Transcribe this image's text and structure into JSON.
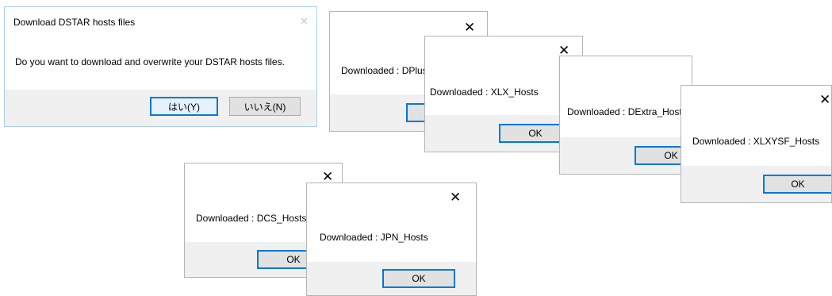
{
  "confirm_dialog": {
    "title": "Download DSTAR hosts files",
    "message": "Do you want to download and overwrite your DSTAR hosts files.",
    "yes_label": "はい(Y)",
    "no_label": "いいえ(N)"
  },
  "close_glyph": "✕",
  "message_boxes": [
    {
      "message": "Downloaded : DPlus_Hosts",
      "ok_label": "OK"
    },
    {
      "message": "Downloaded : XLX_Hosts",
      "ok_label": "OK"
    },
    {
      "message": "Downloaded : DExtra_Hosts",
      "ok_label": "OK"
    },
    {
      "message": "Downloaded : XLXYSF_Hosts",
      "ok_label": "OK"
    },
    {
      "message": "Downloaded : DCS_Hosts",
      "ok_label": "OK"
    },
    {
      "message": "Downloaded : JPN_Hosts",
      "ok_label": "OK"
    }
  ],
  "colors": {
    "accent": "#0078d7",
    "footer": "#f0f0f0",
    "window_border": "#a9cfee"
  }
}
